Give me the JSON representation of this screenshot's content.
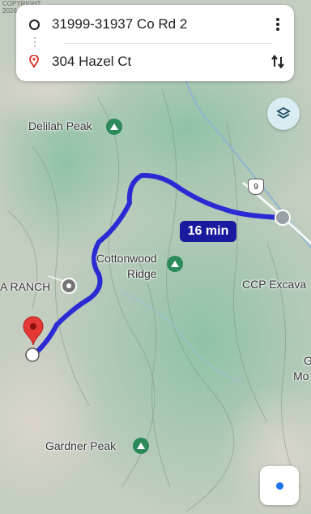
{
  "directions": {
    "origin": "31999-31937 Co Rd 2",
    "destination": "304 Hazel Ct"
  },
  "route": {
    "duration": "16 min",
    "color": "#2b2bd4"
  },
  "highway_shield": "9",
  "copyright": {
    "line1": "COPYRIGHT",
    "line2": "2026"
  },
  "labels": {
    "delilah": "Delilah Peak",
    "cottonwood1": "Cottonwood",
    "cottonwood2": "Ridge",
    "ranch": "A RANCH",
    "ccp": "CCP Excava",
    "gardner": "Gardner Peak",
    "edge_g": "G",
    "edge_mo": "Mo"
  },
  "icons": {
    "origin": "circle-outline-icon",
    "destination": "red-pin-icon",
    "more": "more-vert-icon",
    "swap": "swap-vert-icon",
    "layers": "layers-icon",
    "my_location": "my-location-icon"
  }
}
